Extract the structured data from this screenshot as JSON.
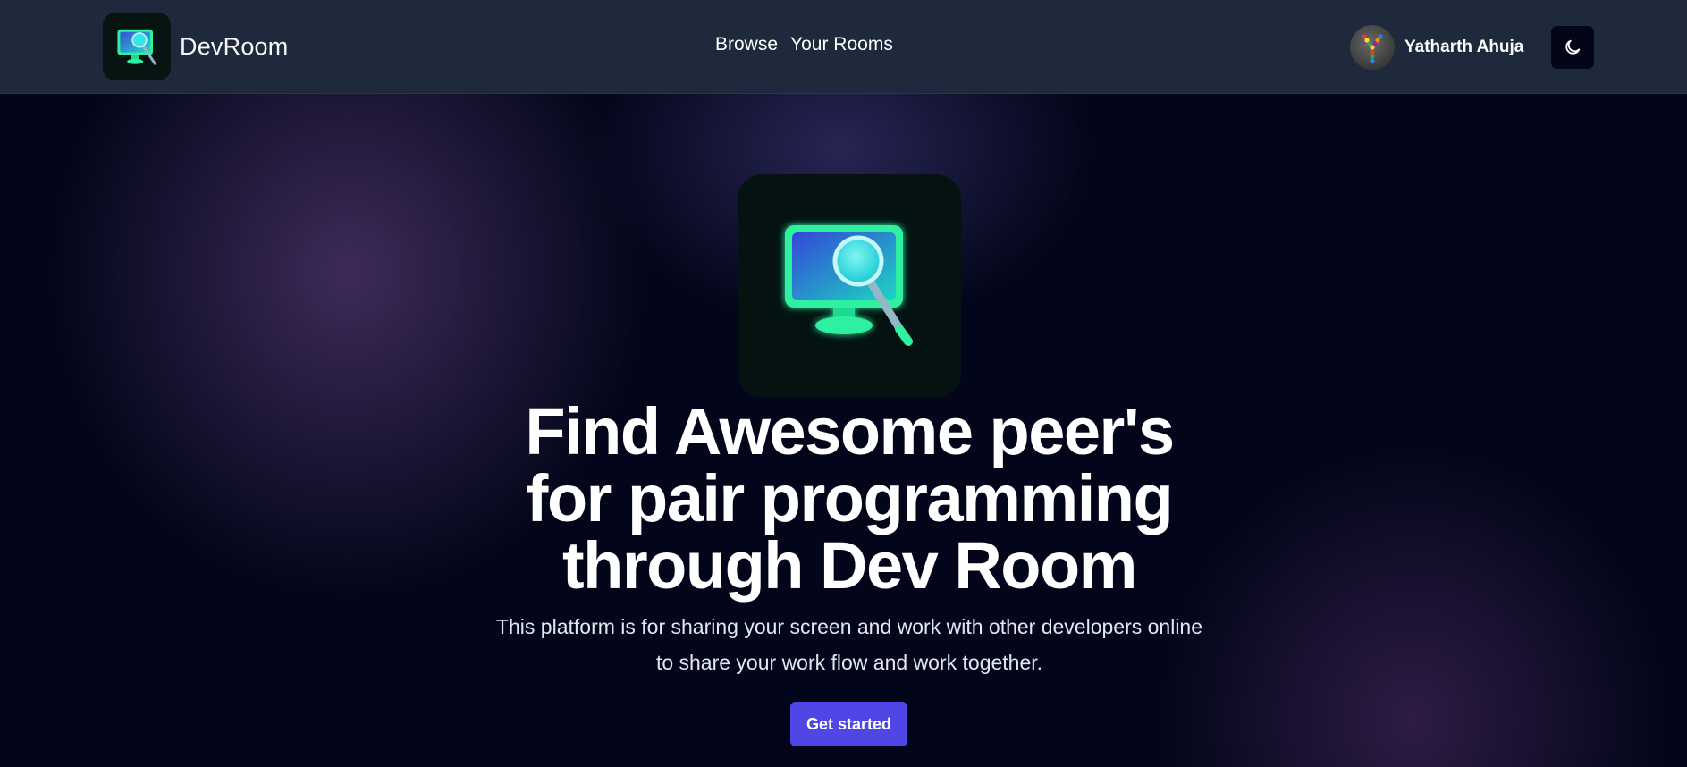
{
  "nav": {
    "brand_name": "DevRoom",
    "links": [
      "Browse",
      "Your Rooms"
    ],
    "user_name": "Yatharth Ahuja"
  },
  "hero": {
    "title_lines": [
      "Find Awesome peer's",
      "for pair programming",
      "through Dev Room"
    ],
    "description_lines": [
      "This platform is for sharing your screen and work with other developers online",
      "to share your work flow and work together."
    ],
    "cta_label": "Get started"
  },
  "icons": {
    "brand": "monitor-magnifier-icon",
    "theme_toggle": "moon-icon",
    "avatar": "avatar-y-icon"
  },
  "colors": {
    "navbar_bg": "#1e293b",
    "page_bg": "#03061a",
    "accent": "#4f46e5",
    "logo_green": "#2ef0a0"
  }
}
